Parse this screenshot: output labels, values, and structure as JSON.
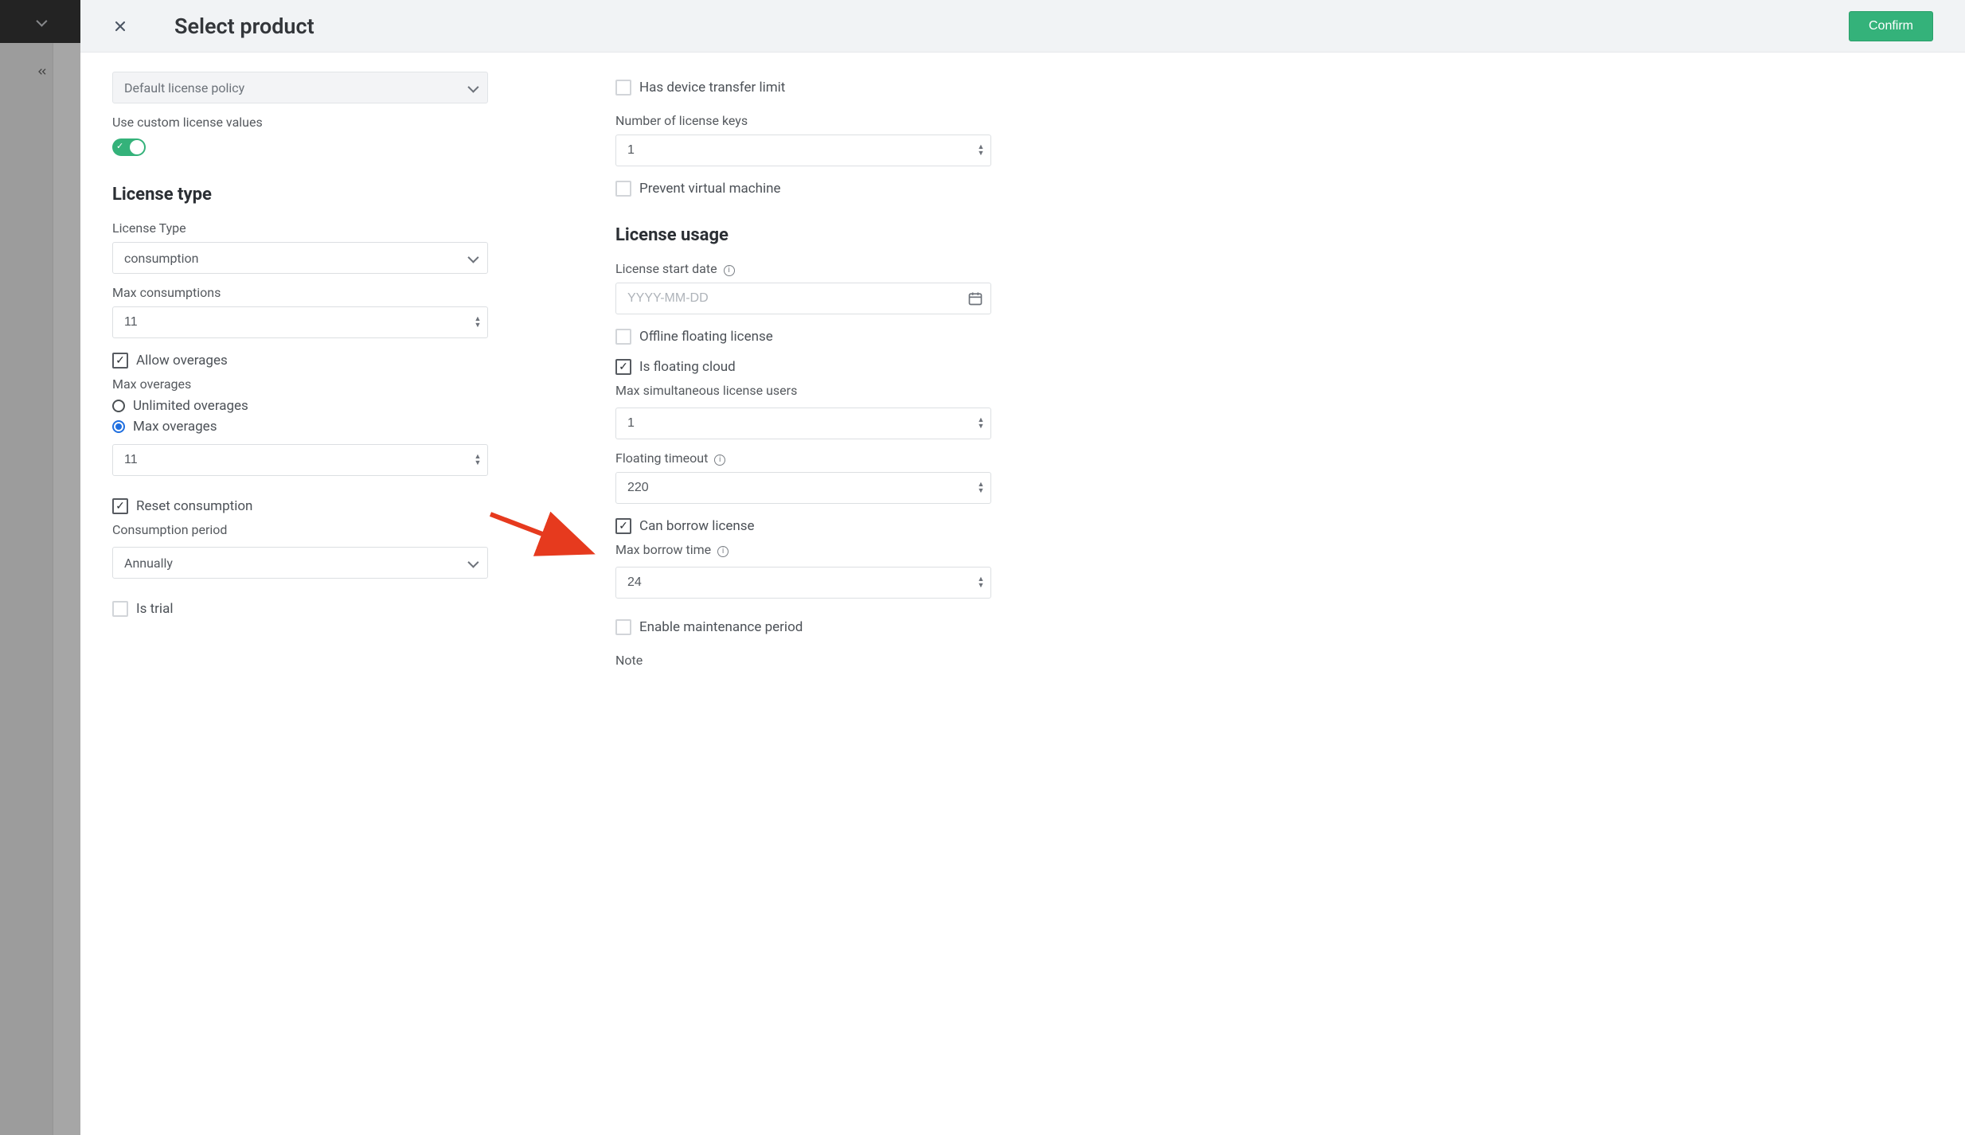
{
  "header": {
    "title": "Select product",
    "confirm": "Confirm"
  },
  "left": {
    "policy_value": "Default license policy",
    "custom_values_label": "Use custom license values",
    "section_license_type": "License type",
    "license_type_label": "License Type",
    "license_type_value": "consumption",
    "max_consumptions_label": "Max consumptions",
    "max_consumptions_value": "11",
    "allow_overages_label": "Allow overages",
    "max_overages_label": "Max overages",
    "radio_unlimited": "Unlimited overages",
    "radio_max": "Max overages",
    "max_overages_value": "11",
    "reset_consumption_label": "Reset consumption",
    "consumption_period_label": "Consumption period",
    "consumption_period_value": "Annually",
    "is_trial_label": "Is trial"
  },
  "right": {
    "has_device_transfer_label": "Has device transfer limit",
    "num_keys_label": "Number of license keys",
    "num_keys_value": "1",
    "prevent_vm_label": "Prevent virtual machine",
    "section_usage": "License usage",
    "start_date_label": "License start date",
    "start_date_placeholder": "YYYY-MM-DD",
    "offline_floating_label": "Offline floating license",
    "is_floating_cloud_label": "Is floating cloud",
    "max_sim_users_label": "Max simultaneous license users",
    "max_sim_users_value": "1",
    "floating_timeout_label": "Floating timeout",
    "floating_timeout_value": "220",
    "can_borrow_label": "Can borrow license",
    "max_borrow_label": "Max borrow time",
    "max_borrow_value": "24",
    "enable_maintenance_label": "Enable maintenance period",
    "note_label": "Note"
  }
}
